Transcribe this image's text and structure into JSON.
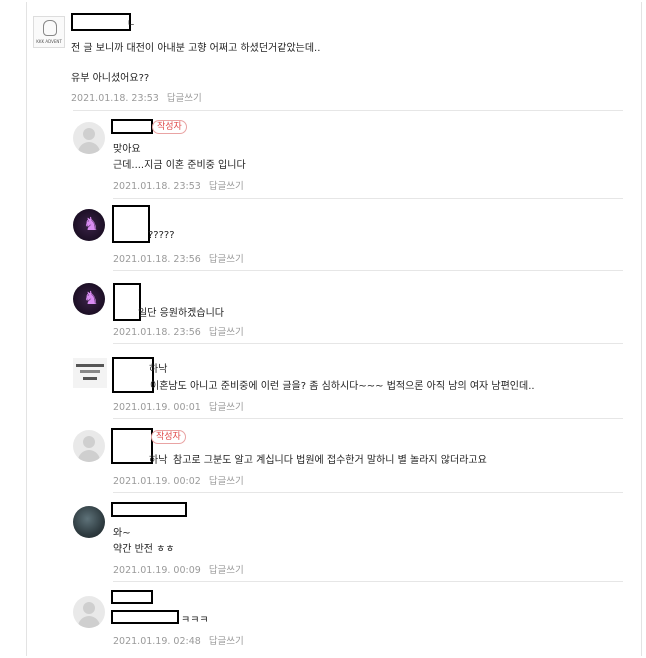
{
  "comments": [
    {
      "lines": [
        "전 글 보니까 대전이 아내분 고향 어쩌고 하셨던거같았는데..",
        "유부 아니셨어요??"
      ],
      "date": "2021.01.18. 23:53",
      "reply": "답글쓰기",
      "name_suffix": "ㄴ",
      "avatar_text": "KKK ADVENT"
    },
    {
      "badge": "작성자",
      "lines": [
        "맞아요",
        "근데....지금 이혼 준비중 입니다"
      ],
      "date": "2021.01.18. 23:53",
      "reply": "답글쓰기"
    },
    {
      "lines": [
        "?????"
      ],
      "date": "2021.01.18. 23:56",
      "reply": "답글쓰기",
      "avatar_glyph": "♞"
    },
    {
      "lines": [
        "일단 응원하겠습니다"
      ],
      "date": "2021.01.18. 23:56",
      "reply": "답글쓰기",
      "avatar_glyph": "♞"
    },
    {
      "name_suffix": "하낙",
      "lines": [
        "이혼남도 아니고 준비중에 이런 글을? 좀 심하시다~~~ 법적으론 아직 남의 여자 남편인데.."
      ],
      "date": "2021.01.19. 00:01",
      "reply": "답글쓰기"
    },
    {
      "badge": "작성자",
      "name_suffix": "하낙",
      "lines": [
        "참고로 그분도 알고 계십니다 법원에 접수한거 말하니 별 놀라지 않더라고요"
      ],
      "date": "2021.01.19. 00:02",
      "reply": "답글쓰기"
    },
    {
      "lines": [
        "와~",
        "약간 반전 ㅎㅎ"
      ],
      "date": "2021.01.19. 00:09",
      "reply": "답글쓰기"
    },
    {
      "lines": [
        "ㅋㅋㅋ"
      ],
      "date": "2021.01.19. 02:48",
      "reply": "답글쓰기"
    }
  ]
}
